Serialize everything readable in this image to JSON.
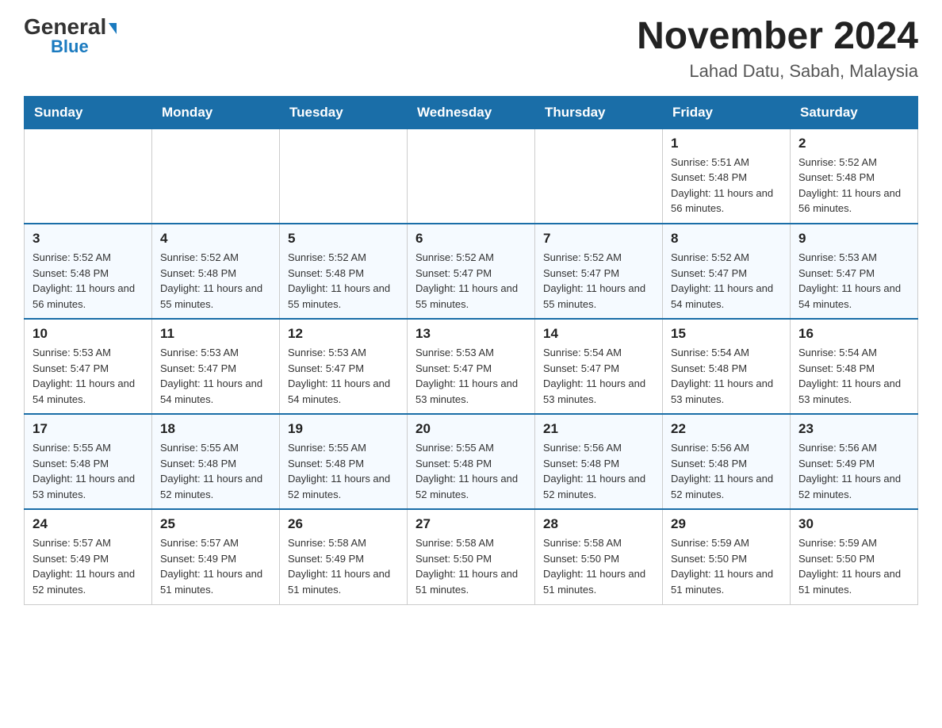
{
  "header": {
    "logo_general": "General",
    "logo_blue": "Blue",
    "title": "November 2024",
    "subtitle": "Lahad Datu, Sabah, Malaysia"
  },
  "days_of_week": [
    "Sunday",
    "Monday",
    "Tuesday",
    "Wednesday",
    "Thursday",
    "Friday",
    "Saturday"
  ],
  "weeks": [
    [
      {
        "day": "",
        "sunrise": "",
        "sunset": "",
        "daylight": ""
      },
      {
        "day": "",
        "sunrise": "",
        "sunset": "",
        "daylight": ""
      },
      {
        "day": "",
        "sunrise": "",
        "sunset": "",
        "daylight": ""
      },
      {
        "day": "",
        "sunrise": "",
        "sunset": "",
        "daylight": ""
      },
      {
        "day": "",
        "sunrise": "",
        "sunset": "",
        "daylight": ""
      },
      {
        "day": "1",
        "sunrise": "Sunrise: 5:51 AM",
        "sunset": "Sunset: 5:48 PM",
        "daylight": "Daylight: 11 hours and 56 minutes."
      },
      {
        "day": "2",
        "sunrise": "Sunrise: 5:52 AM",
        "sunset": "Sunset: 5:48 PM",
        "daylight": "Daylight: 11 hours and 56 minutes."
      }
    ],
    [
      {
        "day": "3",
        "sunrise": "Sunrise: 5:52 AM",
        "sunset": "Sunset: 5:48 PM",
        "daylight": "Daylight: 11 hours and 56 minutes."
      },
      {
        "day": "4",
        "sunrise": "Sunrise: 5:52 AM",
        "sunset": "Sunset: 5:48 PM",
        "daylight": "Daylight: 11 hours and 55 minutes."
      },
      {
        "day": "5",
        "sunrise": "Sunrise: 5:52 AM",
        "sunset": "Sunset: 5:48 PM",
        "daylight": "Daylight: 11 hours and 55 minutes."
      },
      {
        "day": "6",
        "sunrise": "Sunrise: 5:52 AM",
        "sunset": "Sunset: 5:47 PM",
        "daylight": "Daylight: 11 hours and 55 minutes."
      },
      {
        "day": "7",
        "sunrise": "Sunrise: 5:52 AM",
        "sunset": "Sunset: 5:47 PM",
        "daylight": "Daylight: 11 hours and 55 minutes."
      },
      {
        "day": "8",
        "sunrise": "Sunrise: 5:52 AM",
        "sunset": "Sunset: 5:47 PM",
        "daylight": "Daylight: 11 hours and 54 minutes."
      },
      {
        "day": "9",
        "sunrise": "Sunrise: 5:53 AM",
        "sunset": "Sunset: 5:47 PM",
        "daylight": "Daylight: 11 hours and 54 minutes."
      }
    ],
    [
      {
        "day": "10",
        "sunrise": "Sunrise: 5:53 AM",
        "sunset": "Sunset: 5:47 PM",
        "daylight": "Daylight: 11 hours and 54 minutes."
      },
      {
        "day": "11",
        "sunrise": "Sunrise: 5:53 AM",
        "sunset": "Sunset: 5:47 PM",
        "daylight": "Daylight: 11 hours and 54 minutes."
      },
      {
        "day": "12",
        "sunrise": "Sunrise: 5:53 AM",
        "sunset": "Sunset: 5:47 PM",
        "daylight": "Daylight: 11 hours and 54 minutes."
      },
      {
        "day": "13",
        "sunrise": "Sunrise: 5:53 AM",
        "sunset": "Sunset: 5:47 PM",
        "daylight": "Daylight: 11 hours and 53 minutes."
      },
      {
        "day": "14",
        "sunrise": "Sunrise: 5:54 AM",
        "sunset": "Sunset: 5:47 PM",
        "daylight": "Daylight: 11 hours and 53 minutes."
      },
      {
        "day": "15",
        "sunrise": "Sunrise: 5:54 AM",
        "sunset": "Sunset: 5:48 PM",
        "daylight": "Daylight: 11 hours and 53 minutes."
      },
      {
        "day": "16",
        "sunrise": "Sunrise: 5:54 AM",
        "sunset": "Sunset: 5:48 PM",
        "daylight": "Daylight: 11 hours and 53 minutes."
      }
    ],
    [
      {
        "day": "17",
        "sunrise": "Sunrise: 5:55 AM",
        "sunset": "Sunset: 5:48 PM",
        "daylight": "Daylight: 11 hours and 53 minutes."
      },
      {
        "day": "18",
        "sunrise": "Sunrise: 5:55 AM",
        "sunset": "Sunset: 5:48 PM",
        "daylight": "Daylight: 11 hours and 52 minutes."
      },
      {
        "day": "19",
        "sunrise": "Sunrise: 5:55 AM",
        "sunset": "Sunset: 5:48 PM",
        "daylight": "Daylight: 11 hours and 52 minutes."
      },
      {
        "day": "20",
        "sunrise": "Sunrise: 5:55 AM",
        "sunset": "Sunset: 5:48 PM",
        "daylight": "Daylight: 11 hours and 52 minutes."
      },
      {
        "day": "21",
        "sunrise": "Sunrise: 5:56 AM",
        "sunset": "Sunset: 5:48 PM",
        "daylight": "Daylight: 11 hours and 52 minutes."
      },
      {
        "day": "22",
        "sunrise": "Sunrise: 5:56 AM",
        "sunset": "Sunset: 5:48 PM",
        "daylight": "Daylight: 11 hours and 52 minutes."
      },
      {
        "day": "23",
        "sunrise": "Sunrise: 5:56 AM",
        "sunset": "Sunset: 5:49 PM",
        "daylight": "Daylight: 11 hours and 52 minutes."
      }
    ],
    [
      {
        "day": "24",
        "sunrise": "Sunrise: 5:57 AM",
        "sunset": "Sunset: 5:49 PM",
        "daylight": "Daylight: 11 hours and 52 minutes."
      },
      {
        "day": "25",
        "sunrise": "Sunrise: 5:57 AM",
        "sunset": "Sunset: 5:49 PM",
        "daylight": "Daylight: 11 hours and 51 minutes."
      },
      {
        "day": "26",
        "sunrise": "Sunrise: 5:58 AM",
        "sunset": "Sunset: 5:49 PM",
        "daylight": "Daylight: 11 hours and 51 minutes."
      },
      {
        "day": "27",
        "sunrise": "Sunrise: 5:58 AM",
        "sunset": "Sunset: 5:50 PM",
        "daylight": "Daylight: 11 hours and 51 minutes."
      },
      {
        "day": "28",
        "sunrise": "Sunrise: 5:58 AM",
        "sunset": "Sunset: 5:50 PM",
        "daylight": "Daylight: 11 hours and 51 minutes."
      },
      {
        "day": "29",
        "sunrise": "Sunrise: 5:59 AM",
        "sunset": "Sunset: 5:50 PM",
        "daylight": "Daylight: 11 hours and 51 minutes."
      },
      {
        "day": "30",
        "sunrise": "Sunrise: 5:59 AM",
        "sunset": "Sunset: 5:50 PM",
        "daylight": "Daylight: 11 hours and 51 minutes."
      }
    ]
  ]
}
